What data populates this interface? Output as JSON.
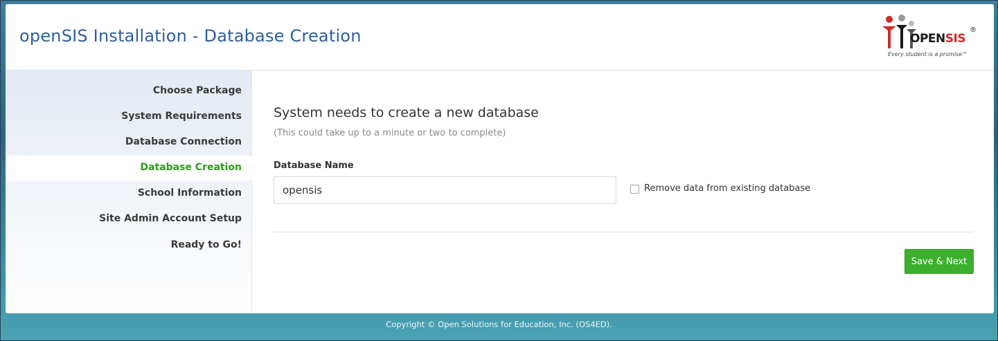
{
  "header": {
    "title": "openSIS Installation - Database Creation",
    "logo": {
      "word_open": "OPEN",
      "word_sis": "SIS",
      "registered": "®",
      "tagline": "Every student is a promise™"
    }
  },
  "sidebar": {
    "items": [
      {
        "label": "Choose Package",
        "active": false
      },
      {
        "label": "System Requirements",
        "active": false
      },
      {
        "label": "Database Connection",
        "active": false
      },
      {
        "label": "Database Creation",
        "active": true
      },
      {
        "label": "School Information",
        "active": false
      },
      {
        "label": "Site Admin Account Setup",
        "active": false
      },
      {
        "label": "Ready to Go!",
        "active": false
      }
    ]
  },
  "main": {
    "heading": "System needs to create a new database",
    "subheading": "(This could take up to a minute or two to complete)",
    "db_name_label": "Database Name",
    "db_name_value": "opensis",
    "remove_data_label": "Remove data from existing database",
    "remove_data_checked": false,
    "save_next_label": "Save & Next"
  },
  "footer": {
    "copyright": "Copyright © Open Solutions for Education, Inc. (OS4ED)."
  },
  "colors": {
    "title_blue": "#2d5f9a",
    "active_green": "#2f9a1e",
    "button_green": "#3cb02c",
    "logo_red": "#d22a2a"
  }
}
